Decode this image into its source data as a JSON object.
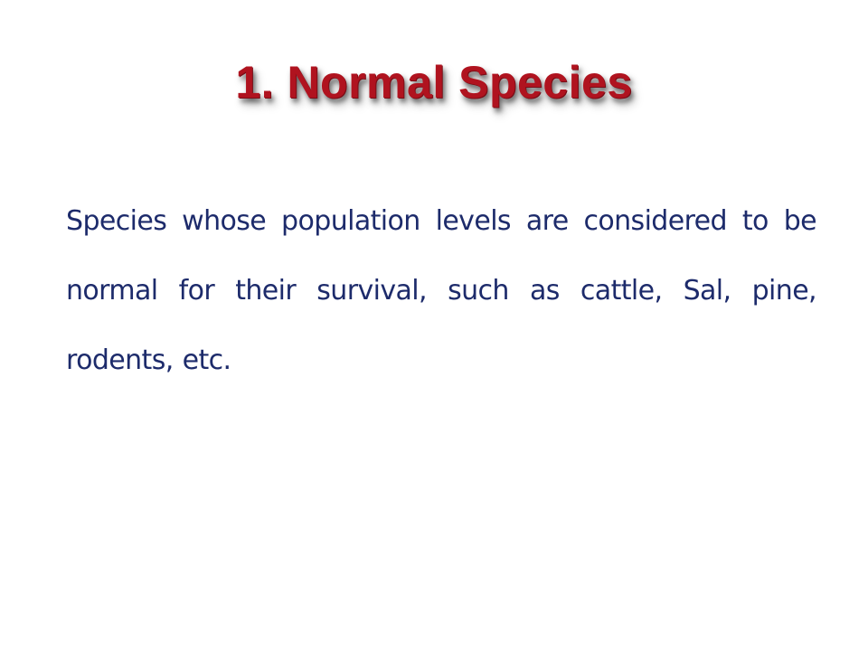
{
  "slide": {
    "title": "1. Normal Species",
    "body": "Species whose population levels are considered to be normal for their survival,  such as cattle, Sal, pine, rodents, etc."
  },
  "colors": {
    "title": "#b0131f",
    "body_text": "#1d2b6b",
    "background": "#ffffff"
  }
}
